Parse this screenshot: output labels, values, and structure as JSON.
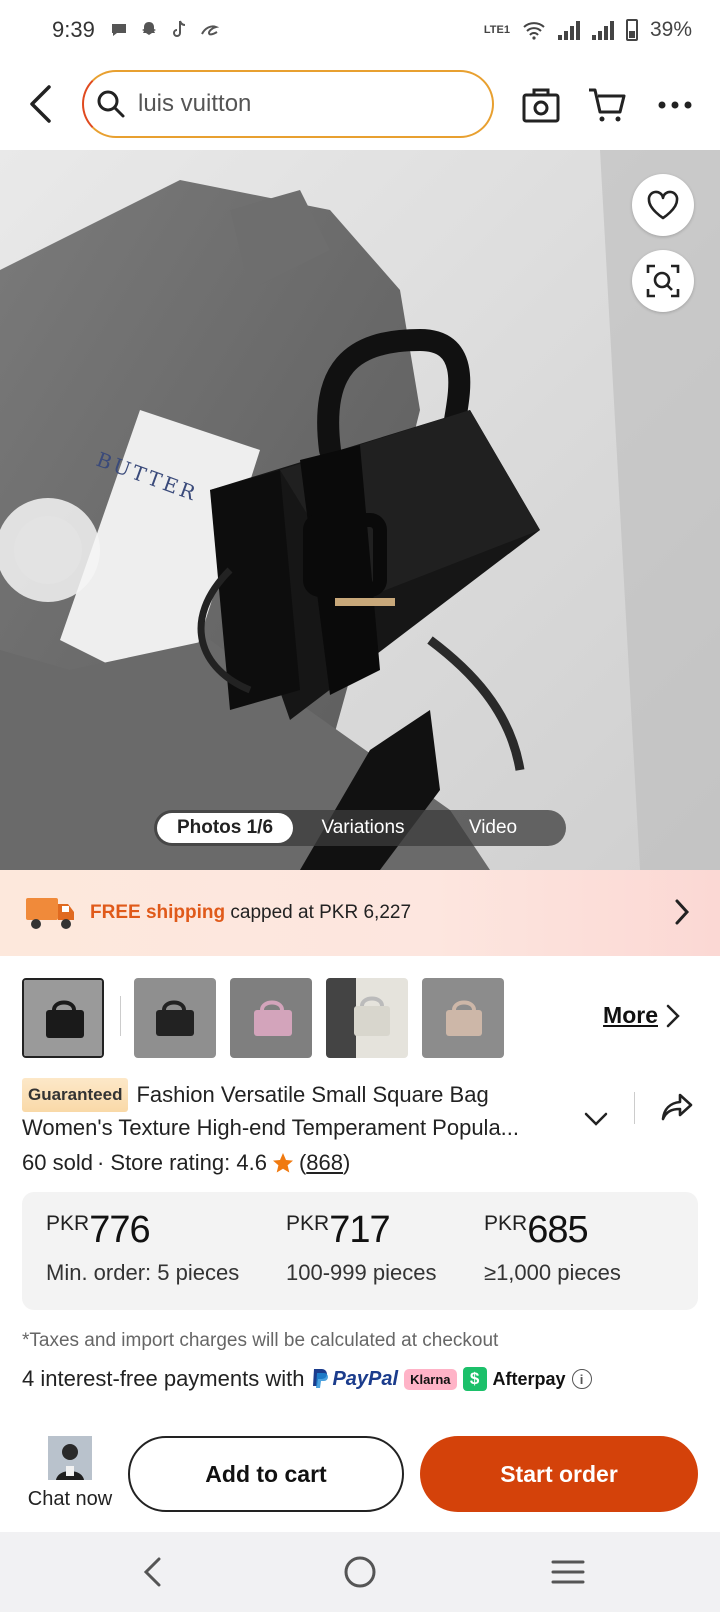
{
  "status_bar": {
    "time": "9:39",
    "network": "LTE1",
    "battery": "39%"
  },
  "header": {
    "search_query": "luis vuitton"
  },
  "hero": {
    "media_tabs": [
      "Photos 1/6",
      "Variations",
      "Video"
    ]
  },
  "shipping": {
    "free_label": "FREE shipping",
    "rest_label": "capped at PKR 6,227"
  },
  "thumbnails": {
    "more_label": "More",
    "colors": [
      "#2b2b2b",
      "#2b2b2b",
      "#c99ab0",
      "#cfcfc8",
      "#c7b2a4"
    ]
  },
  "product": {
    "badge": "Guaranteed",
    "title_line1": "Fashion Versatile Small Square Bag",
    "title_line2": "Women's Texture High-end Temperament Popula...",
    "sold": "60 sold",
    "store_rating_label": "· Store rating: 4.6",
    "review_count_open": "(",
    "review_count": "868",
    "review_count_close": ")"
  },
  "price_tiers": [
    {
      "currency": "PKR",
      "amount": "776",
      "qty": "Min. order: 5 pieces"
    },
    {
      "currency": "PKR",
      "amount": "717",
      "qty": "100-999 pieces"
    },
    {
      "currency": "PKR",
      "amount": "685",
      "qty": "≥1,000 pieces"
    }
  ],
  "taxes_note": "*Taxes and import charges will be calculated at checkout",
  "payments": {
    "lead": "4 interest-free payments with",
    "paypal": "PayPal",
    "klarna": "Klarna",
    "afterpay": "Afterpay"
  },
  "actions": {
    "chat_label": "Chat now",
    "add_to_cart": "Add to cart",
    "start_order": "Start order"
  },
  "colors": {
    "accent_orange": "#d4420a",
    "free_shipping": "#e05a1a",
    "search_border": "#e8a030"
  }
}
